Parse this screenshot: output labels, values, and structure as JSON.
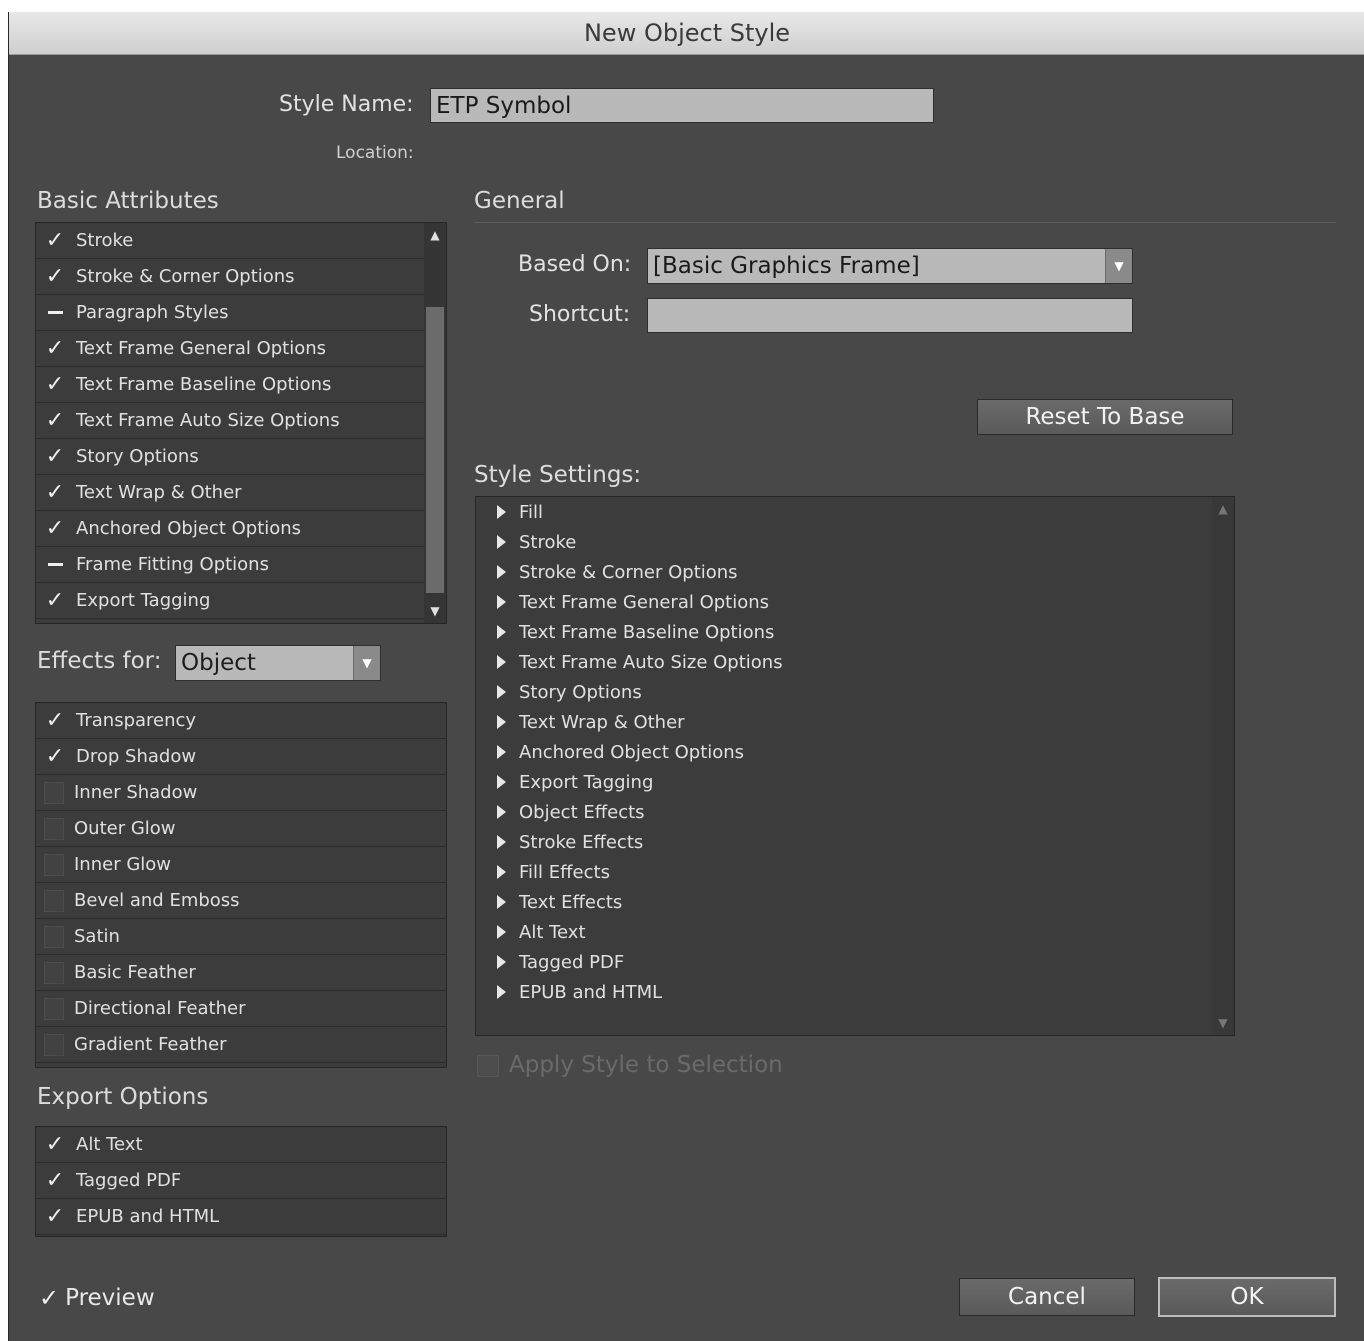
{
  "window": {
    "title": "New Object Style"
  },
  "style_name": {
    "label": "Style Name:",
    "value": "ETP Symbol"
  },
  "location": {
    "label": "Location:"
  },
  "basic_attributes": {
    "title": "Basic Attributes",
    "items": [
      {
        "label": "Stroke",
        "state": "checked"
      },
      {
        "label": "Stroke & Corner Options",
        "state": "checked"
      },
      {
        "label": "Paragraph Styles",
        "state": "mixed"
      },
      {
        "label": "Text Frame General Options",
        "state": "checked"
      },
      {
        "label": "Text Frame Baseline Options",
        "state": "checked"
      },
      {
        "label": "Text Frame Auto Size Options",
        "state": "checked"
      },
      {
        "label": "Story Options",
        "state": "checked"
      },
      {
        "label": "Text Wrap & Other",
        "state": "checked"
      },
      {
        "label": "Anchored Object Options",
        "state": "checked"
      },
      {
        "label": "Frame Fitting Options",
        "state": "mixed"
      },
      {
        "label": "Export Tagging",
        "state": "checked"
      }
    ]
  },
  "effects_for": {
    "label": "Effects for:",
    "value": "Object"
  },
  "effects": {
    "items": [
      {
        "label": "Transparency",
        "state": "checked"
      },
      {
        "label": "Drop Shadow",
        "state": "checked"
      },
      {
        "label": "Inner Shadow",
        "state": "unchecked"
      },
      {
        "label": "Outer Glow",
        "state": "unchecked"
      },
      {
        "label": "Inner Glow",
        "state": "unchecked"
      },
      {
        "label": "Bevel and Emboss",
        "state": "unchecked"
      },
      {
        "label": "Satin",
        "state": "unchecked"
      },
      {
        "label": "Basic Feather",
        "state": "unchecked"
      },
      {
        "label": "Directional Feather",
        "state": "unchecked"
      },
      {
        "label": "Gradient Feather",
        "state": "unchecked"
      }
    ]
  },
  "export_options": {
    "title": "Export Options",
    "items": [
      {
        "label": "Alt Text",
        "state": "checked"
      },
      {
        "label": "Tagged PDF",
        "state": "checked"
      },
      {
        "label": "EPUB and HTML",
        "state": "checked"
      }
    ]
  },
  "preview": {
    "label": "Preview",
    "checked": true
  },
  "general": {
    "title": "General",
    "based_on_label": "Based On:",
    "based_on_value": "[Basic Graphics Frame]",
    "shortcut_label": "Shortcut:",
    "shortcut_value": "",
    "reset_button": "Reset To Base"
  },
  "style_settings": {
    "title": "Style Settings:",
    "items": [
      "Fill",
      "Stroke",
      "Stroke & Corner Options",
      "Text Frame General Options",
      "Text Frame Baseline Options",
      "Text Frame Auto Size Options",
      "Story Options",
      "Text Wrap & Other",
      "Anchored Object Options",
      "Export Tagging",
      "Object Effects",
      "Stroke Effects",
      "Fill Effects",
      "Text Effects",
      "Alt Text",
      "Tagged PDF",
      "EPUB and HTML"
    ]
  },
  "apply_style": {
    "label": "Apply Style to Selection",
    "checked": false,
    "enabled": false
  },
  "buttons": {
    "cancel": "Cancel",
    "ok": "OK"
  }
}
